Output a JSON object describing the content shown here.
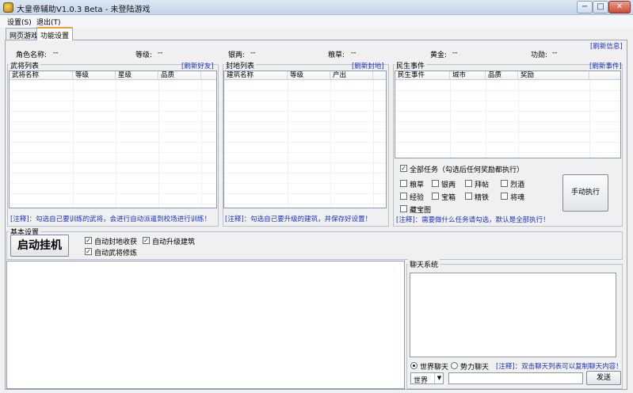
{
  "window": {
    "title": "大皇帝辅助V1.0.3 Beta - 未登陆游戏",
    "min_glyph": "−",
    "max_glyph": "□",
    "close_glyph": "✕"
  },
  "menu": [
    "设置(S)",
    "退出(T)"
  ],
  "tabs": [
    "网页游戏",
    "功能设置"
  ],
  "info": {
    "refresh": "[刷新信息]",
    "fields": [
      {
        "label": "角色名称:",
        "value": "--"
      },
      {
        "label": "等级:",
        "value": "--"
      },
      {
        "label": "银两:",
        "value": "--"
      },
      {
        "label": "粮草:",
        "value": "--"
      },
      {
        "label": "黄金:",
        "value": "--"
      },
      {
        "label": "功勋:",
        "value": "--"
      }
    ]
  },
  "generals": {
    "title": "武将列表",
    "refresh": "[刷新好友]",
    "columns": [
      "武将名称",
      "等级",
      "星级",
      "品质"
    ],
    "note": "[注释]：勾选自己要训练的武将，会进行自动派遣到校场进行训练！"
  },
  "fiefs": {
    "title": "封地列表",
    "refresh": "[刷新封地]",
    "columns": [
      "建筑名称",
      "等级",
      "产出"
    ],
    "note": "[注释]：勾选自己要升级的建筑，并保存好设置！"
  },
  "events": {
    "title": "民生事件",
    "refresh": "[刷新事件]",
    "columns": [
      "民生事件",
      "城市",
      "品质",
      "奖励"
    ],
    "all_tasks": "全部任务（勾选后任何奖励都执行）",
    "options": [
      "粮草",
      "银两",
      "拜帖",
      "烈酒",
      "经验",
      "宝箱",
      "精铁",
      "将魂",
      "藏宝图"
    ],
    "execute": "手动执行",
    "note": "[注释]：需要做什么任务请勾选，默认是全部执行！"
  },
  "basic": {
    "title": "基本设置",
    "start": "启动挂机",
    "options": [
      "自动封地收获",
      "自动升级建筑",
      "自动武将修炼"
    ]
  },
  "chat": {
    "title": "聊天系统",
    "radio_world": "世界聊天",
    "radio_faction": "势力聊天",
    "note": "[注释]：双击聊天列表可以复制聊天内容！",
    "channel": "世界",
    "send": "发送"
  }
}
